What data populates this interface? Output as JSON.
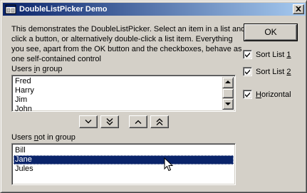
{
  "window": {
    "title": "DoubleListPicker Demo",
    "close_icon": "close-icon"
  },
  "description": {
    "lines": [
      "This demonstrates the DoubleListPicker. Select an item in a list and",
      "click a button, or alternatively double-click a list item. Everything",
      "you see, apart from the OK button and the checkboxes, behave as",
      "one self-contained control"
    ]
  },
  "users_in_group": {
    "label_pre": "Users ",
    "label_u": "i",
    "label_post": "n group",
    "items": [
      "Fred",
      "Harry",
      "Jim",
      "John"
    ]
  },
  "move_buttons": {
    "move_down": "chevron-down-icon",
    "move_all_down": "double-chevron-down-icon",
    "move_up": "chevron-up-icon",
    "move_all_up": "double-chevron-up-icon"
  },
  "users_not_in_group": {
    "label_pre": "Users ",
    "label_u": "n",
    "label_post": "ot in group",
    "items": [
      "Bill",
      "Jane",
      "Jules"
    ],
    "selected": "Jane"
  },
  "ok_button": {
    "label": "OK"
  },
  "checkboxes": [
    {
      "pre": "Sort List ",
      "u": "1",
      "post": "",
      "checked": true
    },
    {
      "pre": "Sort List ",
      "u": "2",
      "post": "",
      "checked": true
    },
    {
      "pre": "",
      "u": "H",
      "post": "orizontal",
      "checked": true
    }
  ],
  "colors": {
    "face": "#d4d0c8",
    "selection": "#0a246a",
    "title_gradient_start": "#0a246a",
    "title_gradient_end": "#a6caf0"
  }
}
